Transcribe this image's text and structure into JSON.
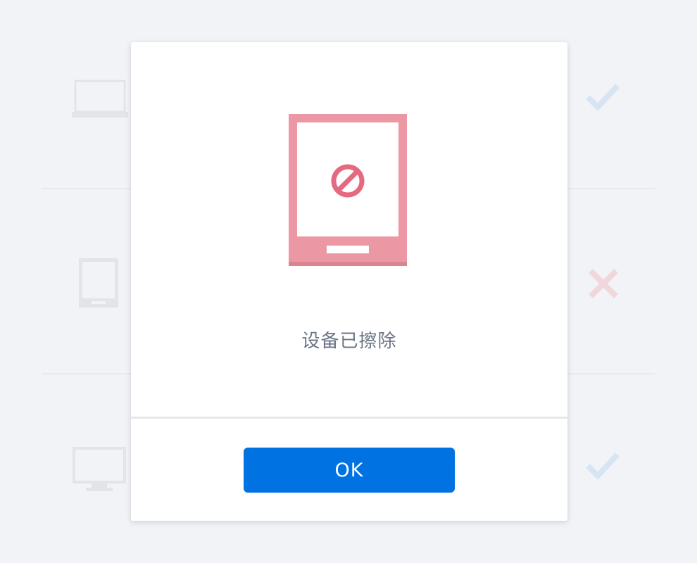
{
  "background": {
    "devices": [
      {
        "icon": "laptop-icon",
        "status": "success-check-icon"
      },
      {
        "icon": "tablet-icon",
        "status": "failure-cross-icon"
      },
      {
        "icon": "desktop-monitor-icon",
        "status": "success-check-icon"
      }
    ],
    "colors": {
      "page_bg": "#f1f3f7",
      "device_icon": "#e2e4e8",
      "check": "#d7e4f4",
      "cross": "#f1d7dc"
    }
  },
  "dialog": {
    "illustration": "tablet-blocked-icon",
    "message": "设备已擦除",
    "ok_label": "OK",
    "colors": {
      "tablet": "#ec98a4",
      "tablet_shadow": "#d9848f",
      "block_sign": "#e5697f",
      "button": "#0072e2",
      "message_text": "#6b7585"
    }
  }
}
